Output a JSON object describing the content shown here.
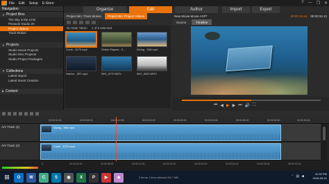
{
  "menubar": {
    "items": [
      "File",
      "Edit",
      "Setup",
      "E-Store"
    ],
    "window_controls": [
      "?",
      "—",
      "❐",
      "✕"
    ]
  },
  "modes": {
    "organize": "Organize",
    "edit": "Edit",
    "author": "Author",
    "import": "Import",
    "export": "Export"
  },
  "library": {
    "nav_title": "Navigation",
    "sections": [
      {
        "title": "Project Bins",
        "items": [
          "The Sky is the Limit",
          "Pinnacle Studio 20",
          "Project Videos",
          "Track Motion"
        ],
        "selected": 2
      },
      {
        "title": "Projects",
        "items": [
          "Studio Movie Projects",
          "Studio Disc Projects",
          "Studio Project Packages"
        ]
      },
      {
        "title": "Collections",
        "items": [
          "Latest Import",
          "Latest Smart Creation"
        ]
      },
      {
        "title": "Content",
        "items": []
      }
    ],
    "tabs": [
      "Project Bin: Track Motion",
      "Project Bin: Project Videos"
    ],
    "active_tab": 1,
    "filter_text": "No Date Taken",
    "selection_text": "1 of 6 selected",
    "items": [
      {
        "caption": "Coral - 3270.mp4",
        "selected": true
      },
      {
        "caption": "Guitar Players - 3...",
        "selected": false
      },
      {
        "caption": "Diving - 908.mp4",
        "selected": false
      },
      {
        "caption": "",
        "selected": false
      },
      {
        "caption": "Harbor - 902.mp4",
        "selected": false
      },
      {
        "caption": "IMG_5270.MOV",
        "selected": false
      },
      {
        "caption": "IMG_5810.MOV",
        "selected": false
      },
      {
        "caption": "",
        "selected": false
      }
    ]
  },
  "player": {
    "title": "New Movie.Movie.AXP*",
    "timecode": "00:00:33.24",
    "duration": "00:00:34.13",
    "tabs": [
      "Source",
      "Timeline"
    ],
    "active_tab": 1
  },
  "timeline": {
    "ruler_ticks": [
      "00:00:04.00",
      "00:00:08.00",
      "00:00:12.00",
      "00:00:16.00",
      "00:00:20.00",
      "00:00:24.00",
      "00:00:28.00",
      "00:00:32.00",
      "00:00:36.00"
    ],
    "tracks": [
      {
        "name": "A/V Track (1)",
        "clip_label": "Diving - 908.mp4"
      },
      {
        "name": "A/V Track (2)",
        "clip_label": "Coral - 3270.mp4"
      }
    ],
    "bottom_ticks": [
      "0",
      "00:00:04.00",
      "00:00:08.00",
      "00:00:12.00",
      "00:00:16.00",
      "00:00:20.00",
      "00:00:24.00",
      "00:00:28.00",
      "00:00:32.00"
    ]
  },
  "taskbar": {
    "apps": [
      {
        "label": "O",
        "color": "#0f6cbd"
      },
      {
        "label": "W",
        "color": "#2b579a"
      },
      {
        "label": "C",
        "color": "#4a8"
      },
      {
        "label": "S",
        "color": "#07a"
      },
      {
        "label": "◉",
        "color": "#555"
      },
      {
        "label": "X",
        "color": "#217346"
      },
      {
        "label": "P",
        "color": "#333"
      },
      {
        "label": "▶",
        "color": "#c33"
      },
      {
        "label": "◆",
        "color": "#b8c"
      }
    ],
    "status_text": "2 items   1 item selected  30.7 MB",
    "time": "10:32 PM",
    "date": "2016-09-21"
  },
  "colors": {
    "accent": "#e8720c",
    "clip": "#5aa3d6",
    "playhead": "#ee5533"
  }
}
